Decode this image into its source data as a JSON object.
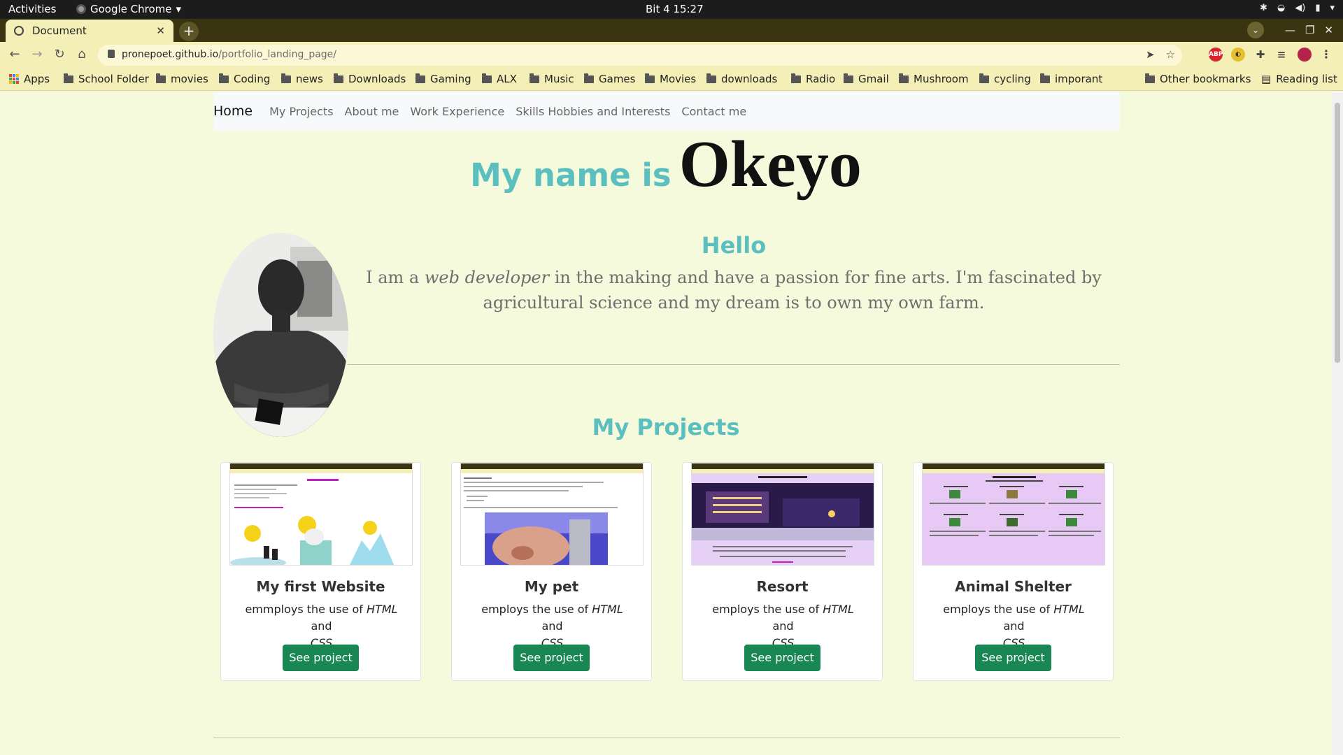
{
  "system": {
    "activities": "Activities",
    "app_name": "Google Chrome",
    "clock": "Bit 4  15:27"
  },
  "browser": {
    "tab_title": "Document",
    "url_host": "pronepoet.github.io",
    "url_path": "/portfolio_landing_page/",
    "bookmarks": [
      "Apps",
      "School Folder",
      "movies",
      "Coding",
      "news",
      "Downloads",
      "Gaming",
      "ALX",
      "Music",
      "Games",
      "Movies",
      "downloads",
      "Radio",
      "Gmail",
      "Mushroom",
      "cycling",
      "imporant"
    ],
    "other_bookmarks": "Other bookmarks",
    "reading_list": "Reading list",
    "extensions": {
      "abp": "ABP"
    }
  },
  "page": {
    "nav": {
      "brand": "Home",
      "links": [
        "My Projects",
        "About me",
        "Work Experience",
        "Skills Hobbies and Interests",
        "Contact me"
      ]
    },
    "headline_pre": "My name is",
    "headline_name": "Okeyo",
    "hello": "Hello",
    "bio": {
      "pre": "I am a ",
      "em": "web developer",
      "post": " in the making and have a passion for fine arts. I'm fascinated by agricultural science and my dream is to own my own farm."
    },
    "projects_heading": "My Projects",
    "projects": [
      {
        "title": "My first Website",
        "desc_pre": "emmploys the use of ",
        "html": "HTML",
        "and": " and ",
        "css": "CSS",
        "button": "See project"
      },
      {
        "title": "My pet",
        "desc_pre": "employs the use of ",
        "html": "HTML",
        "and": " and ",
        "css": "CSS",
        "button": "See project"
      },
      {
        "title": "Resort",
        "desc_pre": "employs the use of ",
        "html": "HTML",
        "and": " and ",
        "css": "CSS",
        "button": "See project"
      },
      {
        "title": "Animal Shelter",
        "desc_pre": "employs the use of ",
        "html": "HTML",
        "and": " and ",
        "css": "CSS",
        "button": "See project"
      }
    ],
    "colors": {
      "background": "#f5fadc",
      "accent_teal": "#5bbfbf",
      "button_green": "#198754",
      "chrome_frame": "#3a3510",
      "chrome_toolbar": "#f4efb6"
    }
  }
}
